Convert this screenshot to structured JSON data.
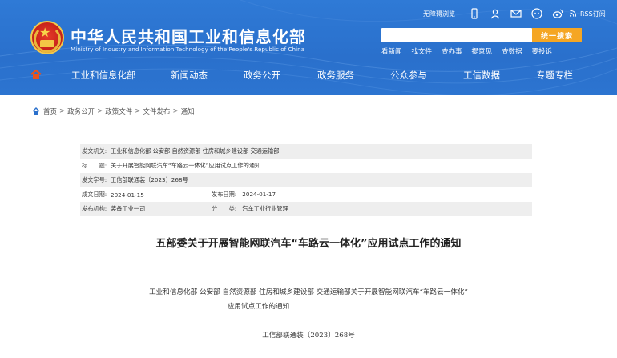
{
  "header": {
    "site_title": "中华人民共和国工业和信息化部",
    "site_subtitle": "Ministry of Industry and Information Technology of the People's Republic of China",
    "accessibility_label": "无障碍浏览",
    "rss_label": "RSS订阅",
    "search_button": "统一搜索",
    "search_placeholder": "",
    "quick_links": [
      "看新闻",
      "找文件",
      "查办事",
      "提意见",
      "查数据",
      "要投诉"
    ]
  },
  "nav": {
    "items": [
      "工业和信息化部",
      "新闻动态",
      "政务公开",
      "政务服务",
      "公众参与",
      "工信数据",
      "专题专栏"
    ]
  },
  "breadcrumb": {
    "items": [
      "首页",
      "政务公开",
      "政策文件",
      "文件发布",
      "通知"
    ],
    "separator": ">"
  },
  "info": {
    "issuer_label": "发文机关:",
    "issuer_value": "工业和信息化部 公安部 自然资源部 住房和城乡建设部 交通运输部",
    "title_label": "标　　题:",
    "title_value": "关于开展智能网联汽车“车路云一体化”应用试点工作的通知",
    "docno_label": "发文字号:",
    "docno_value": "工信部联通装〔2023〕268号",
    "date_label": "成文日期:",
    "date_value": "2024-01-15",
    "pubdate_label": "发布日期:",
    "pubdate_value": "2024-01-17",
    "org_label": "发布机构:",
    "org_value": "装备工业一司",
    "category_label": "分　　类:",
    "category_value": "汽车工业行业管理"
  },
  "document": {
    "title": "五部委关于开展智能网联汽车“车路云一体化”应用试点工作的通知",
    "body_line1": "工业和信息化部  公安部  自然资源部  住房和城乡建设部  交通运输部关于开展智能网联汽车“车路云一体化”",
    "body_line2": "应用试点工作的通知",
    "number": "工信部联通装〔2023〕268号"
  },
  "colors": {
    "header_blue": "#2a70cc",
    "search_button": "#f5a623",
    "emblem_red": "#c9231a"
  }
}
